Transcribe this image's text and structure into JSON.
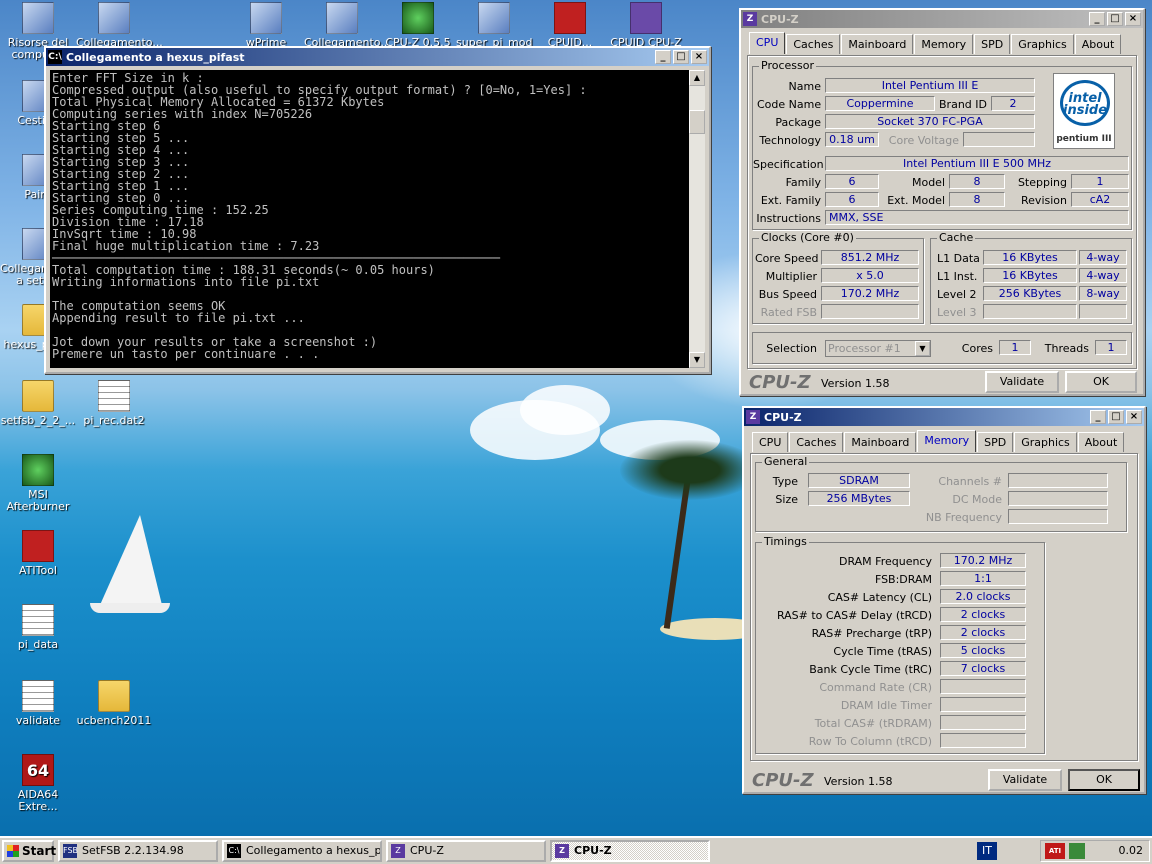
{
  "desktop": {
    "icons": [
      {
        "label": "Risorse del computer"
      },
      {
        "label": "Collegamento..."
      },
      {
        "label": "wPrime"
      },
      {
        "label": "Collegamento..."
      },
      {
        "label": "CPU-Z 0.5.5"
      },
      {
        "label": "super_pi_mod"
      },
      {
        "label": "CPUID..."
      },
      {
        "label": "CPUID CPU-Z"
      },
      {
        "label": "Cestino"
      },
      {
        "label": "Paint"
      },
      {
        "label": "Collegamento a setfsb"
      },
      {
        "label": "hexus_pifast"
      },
      {
        "label": "setfsb_2_2_..."
      },
      {
        "label": "pi_rec.dat2"
      },
      {
        "label": "MSI Afterburner"
      },
      {
        "label": "ATITool"
      },
      {
        "label": "pi_data"
      },
      {
        "label": "validate"
      },
      {
        "label": "ucbench2011"
      },
      {
        "label": "AIDA64 Extre..."
      }
    ]
  },
  "console_window": {
    "title": "Collegamento a hexus_pifast",
    "lines": [
      "Enter FFT Size in k :",
      "Compressed output (also useful to specify output format) ? [0=No, 1=Yes] :",
      "Total Physical Memory Allocated = 61372 Kbytes",
      "Computing series with index N=705226",
      "Starting step 6",
      "Starting step 5 ...",
      "Starting step 4 ...",
      "Starting step 3 ...",
      "Starting step 2 ...",
      "Starting step 1 ...",
      "Starting step 0 ...",
      "Series computing time : 152.25",
      "Division time : 17.18",
      "InvSqrt time : 10.98",
      "Final huge multiplication time : 7.23",
      "──────────────────────────────────────────────────────────────",
      "Total computation time : 188.31 seconds(~ 0.05 hours)",
      "Writing informations into file pi.txt",
      "",
      "The computation seems OK",
      "Appending result to file pi.txt ...",
      "",
      "Jot down your results or take a screenshot :)",
      "Premere un tasto per continuare . . ."
    ]
  },
  "cpuz1": {
    "title": "CPU-Z",
    "tabs": [
      "CPU",
      "Caches",
      "Mainboard",
      "Memory",
      "SPD",
      "Graphics",
      "About"
    ],
    "processor_label": "Processor",
    "name_label": "Name",
    "name": "Intel Pentium III E",
    "codename_label": "Code Name",
    "codename": "Coppermine",
    "brandid_label": "Brand ID",
    "brandid": "2",
    "package_label": "Package",
    "package": "Socket 370 FC-PGA",
    "tech_label": "Technology",
    "tech": "0.18 um",
    "corevoltage_label": "Core Voltage",
    "spec_label": "Specification",
    "spec": "Intel Pentium III E 500 MHz",
    "family_label": "Family",
    "family": "6",
    "model_label": "Model",
    "model": "8",
    "stepping_label": "Stepping",
    "stepping": "1",
    "extfamily_label": "Ext. Family",
    "extfamily": "6",
    "extmodel_label": "Ext. Model",
    "extmodel": "8",
    "revision_label": "Revision",
    "revision": "cA2",
    "instr_label": "Instructions",
    "instr": "MMX, SSE",
    "clocks_label": "Clocks (Core #0)",
    "corespeed_label": "Core Speed",
    "corespeed": "851.2 MHz",
    "multiplier_label": "Multiplier",
    "multiplier": "x 5.0",
    "busspeed_label": "Bus Speed",
    "busspeed": "170.2 MHz",
    "ratedfsb_label": "Rated FSB",
    "cache_label": "Cache",
    "l1d_label": "L1 Data",
    "l1d": "16 KBytes",
    "l1d_way": "4-way",
    "l1i_label": "L1 Inst.",
    "l1i": "16 KBytes",
    "l1i_way": "4-way",
    "l2_label": "Level 2",
    "l2": "256 KBytes",
    "l2_way": "8-way",
    "l3_label": "Level 3",
    "selection_label": "Selection",
    "selection": "Processor #1",
    "cores_label": "Cores",
    "cores": "1",
    "threads_label": "Threads",
    "threads": "1",
    "brand": "CPU-Z",
    "version": "Version 1.58",
    "validate": "Validate",
    "ok": "OK",
    "logo_inside": "intel inside",
    "logo_pentium": "pentium III"
  },
  "cpuz2": {
    "title": "CPU-Z",
    "tabs": [
      "CPU",
      "Caches",
      "Mainboard",
      "Memory",
      "SPD",
      "Graphics",
      "About"
    ],
    "general_label": "General",
    "type_label": "Type",
    "type": "SDRAM",
    "size_label": "Size",
    "size": "256 MBytes",
    "channels_label": "Channels #",
    "dcmode_label": "DC Mode",
    "nbfreq_label": "NB Frequency",
    "timings_label": "Timings",
    "timings": [
      {
        "label": "DRAM Frequency",
        "value": "170.2 MHz"
      },
      {
        "label": "FSB:DRAM",
        "value": "1:1"
      },
      {
        "label": "CAS# Latency (CL)",
        "value": "2.0 clocks"
      },
      {
        "label": "RAS# to CAS# Delay (tRCD)",
        "value": "2 clocks"
      },
      {
        "label": "RAS# Precharge (tRP)",
        "value": "2 clocks"
      },
      {
        "label": "Cycle Time (tRAS)",
        "value": "5 clocks"
      },
      {
        "label": "Bank Cycle Time (tRC)",
        "value": "7 clocks"
      },
      {
        "label": "Command Rate (CR)",
        "value": ""
      },
      {
        "label": "DRAM Idle Timer",
        "value": ""
      },
      {
        "label": "Total CAS# (tRDRAM)",
        "value": ""
      },
      {
        "label": "Row To Column (tRCD)",
        "value": ""
      }
    ],
    "brand": "CPU-Z",
    "version": "Version 1.58",
    "validate": "Validate",
    "ok": "OK"
  },
  "taskbar": {
    "start": "Start",
    "tasks": [
      {
        "label": "SetFSB 2.2.134.98"
      },
      {
        "label": "Collegamento a hexus_pi..."
      },
      {
        "label": "CPU-Z"
      },
      {
        "label": "CPU-Z"
      }
    ],
    "lang": "IT",
    "clock": "0.02"
  }
}
